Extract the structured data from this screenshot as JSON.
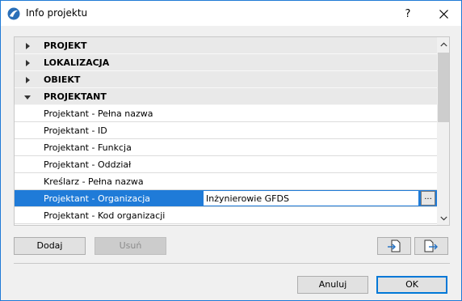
{
  "window": {
    "title": "Info projektu",
    "help_label": "?"
  },
  "tree": {
    "groups_top": [
      {
        "label": "PROJEKT",
        "expanded": false
      },
      {
        "label": "LOKALIZACJA",
        "expanded": false
      },
      {
        "label": "OBIEKT",
        "expanded": false
      },
      {
        "label": "PROJEKTANT",
        "expanded": true
      }
    ],
    "items": [
      {
        "label": "Projektant - Pełna nazwa",
        "value": ""
      },
      {
        "label": "Projektant - ID",
        "value": ""
      },
      {
        "label": "Projektant - Funkcja",
        "value": ""
      },
      {
        "label": "Projektant - Oddział",
        "value": ""
      },
      {
        "label": "Kreślarz - Pełna nazwa",
        "value": ""
      },
      {
        "label": "Projektant - Organizacja",
        "value": "Inżynierowie GFDS",
        "selected": true
      },
      {
        "label": "Projektant - Kod organizacji",
        "value": ""
      }
    ],
    "ellipsis_label": "..."
  },
  "buttons": {
    "add_label": "Dodaj",
    "remove_label": "Usuń",
    "cancel_label": "Anuluj",
    "ok_label": "OK"
  },
  "colors": {
    "accent": "#1f7bd8",
    "border": "#1f7ad6"
  }
}
